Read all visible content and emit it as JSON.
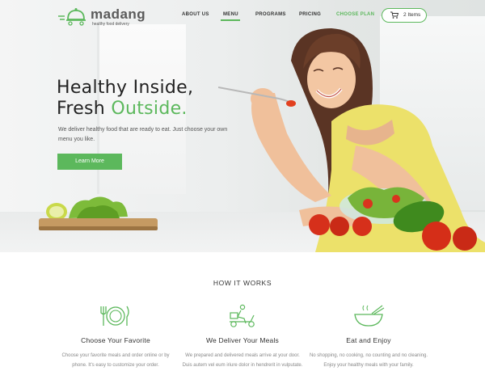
{
  "brand": {
    "name": "madang",
    "tagline": "healthy food delivery",
    "accent": "#5cb85c"
  },
  "nav": {
    "items": [
      {
        "label": "ABOUT US"
      },
      {
        "label": "MENU",
        "active": true
      },
      {
        "label": "PROGRAMS"
      },
      {
        "label": "PRICING"
      },
      {
        "label": "CHOOSE PLAN"
      }
    ],
    "cart_label": "2 Items",
    "cart_icon": "cart-icon"
  },
  "hero": {
    "title_line1": "Healthy Inside,",
    "title_line2_prefix": "Fresh ",
    "title_line2_accent": "Outside.",
    "lead": "We deliver healthy food that are ready to eat. Just choose your own menu you like.",
    "cta_label": "Learn More"
  },
  "how": {
    "title": "HOW IT WORKS",
    "features": [
      {
        "icon": "plate-cutlery-icon",
        "title": "Choose Your Favorite",
        "desc": "Choose your favorite meals and order online or by phone. It's easy to customize your order."
      },
      {
        "icon": "delivery-scooter-icon",
        "title": "We Deliver Your Meals",
        "desc": "We prepared and delivered meals arrive at your door. Duis autem vel eum iriure dolor in hendrerit in vulputate."
      },
      {
        "icon": "bowl-chopsticks-icon",
        "title": "Eat and Enjoy",
        "desc": "No shopping, no cooking, no counting and no cleaning. Enjoy your healthy meals with your family."
      }
    ]
  }
}
